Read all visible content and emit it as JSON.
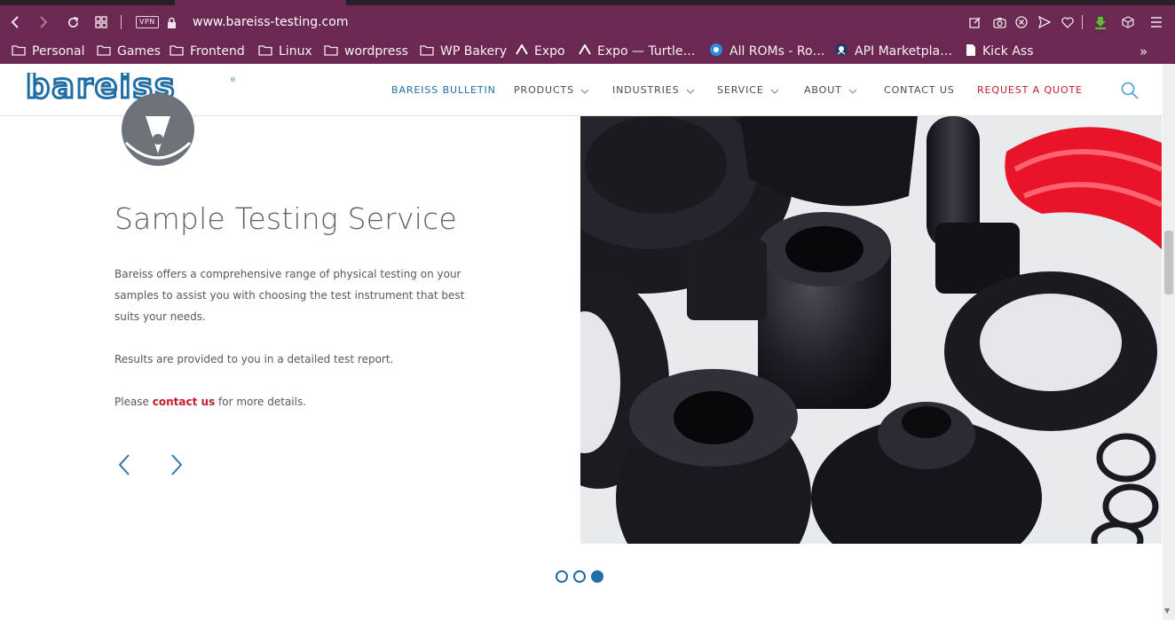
{
  "browser": {
    "url": "www.bareiss-testing.com",
    "vpn_label": "VPN",
    "bookmarks": [
      {
        "label": "Personal",
        "icon": "folder-icon"
      },
      {
        "label": "Games",
        "icon": "folder-icon"
      },
      {
        "label": "Frontend",
        "icon": "folder-icon"
      },
      {
        "label": "Linux",
        "icon": "folder-icon"
      },
      {
        "label": "wordpress",
        "icon": "folder-icon"
      },
      {
        "label": "WP Bakery",
        "icon": "folder-icon"
      },
      {
        "label": "Expo",
        "icon": "expo-icon"
      },
      {
        "label": "Expo — Turtle…",
        "icon": "expo-icon"
      },
      {
        "label": "All ROMs - Ro…",
        "icon": "roms-site-icon"
      },
      {
        "label": "API Marketpla…",
        "icon": "api-marketplace-icon"
      },
      {
        "label": "Kick Ass",
        "icon": "document-icon"
      }
    ],
    "more_label": "»"
  },
  "site": {
    "logo_text": "bareiss",
    "nav": [
      {
        "label": "BAREISS BULLETIN",
        "dropdown": false
      },
      {
        "label": "PRODUCTS",
        "dropdown": true
      },
      {
        "label": "INDUSTRIES",
        "dropdown": true
      },
      {
        "label": "SERVICE",
        "dropdown": true
      },
      {
        "label": "ABOUT",
        "dropdown": true
      },
      {
        "label": "CONTACT US",
        "dropdown": false
      },
      {
        "label": "REQUEST A QUOTE",
        "dropdown": false
      }
    ],
    "colors": {
      "brand_blue": "#1f6fa6",
      "accent_red": "#c61c2c",
      "browser_purple": "#6b2850"
    }
  },
  "content": {
    "title": "Sample Testing Service",
    "paragraph1": "Bareiss offers a comprehensive range of physical testing on your samples to assist you with choosing the test instrument that best suits your needs.",
    "paragraph2": "Results are provided to you in a detailed test report.",
    "paragraph3_before": "Please ",
    "paragraph3_link": "contact us",
    "paragraph3_after": " for more details.",
    "slider": {
      "total_slides": 3,
      "active_slide": 3
    }
  }
}
